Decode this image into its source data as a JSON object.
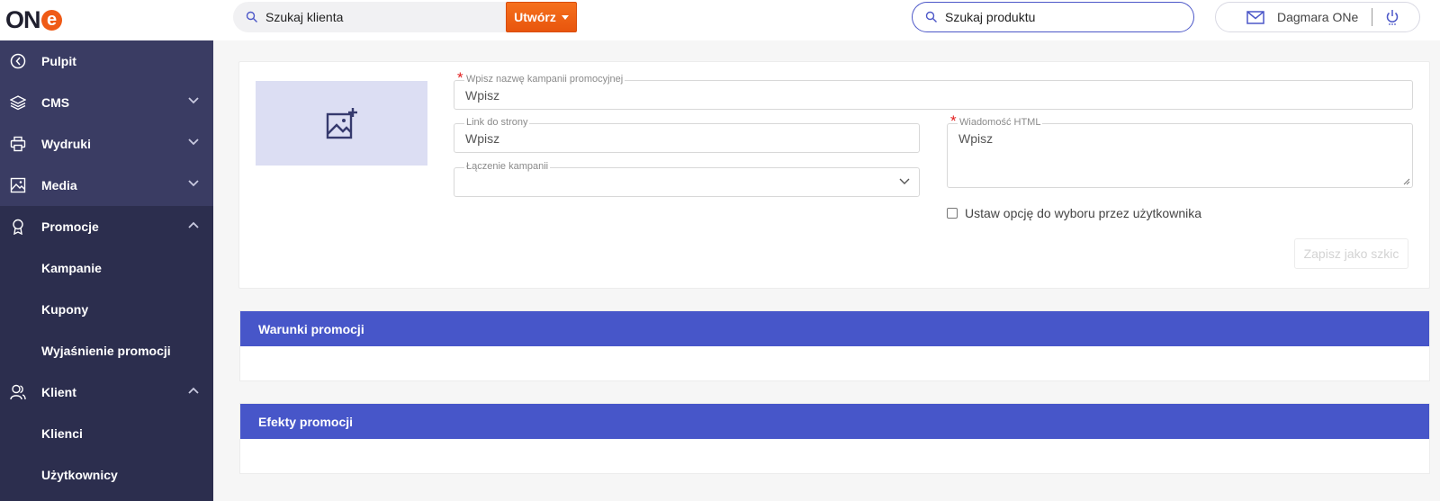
{
  "header": {
    "logo_text": "ON",
    "logo_e": "e",
    "client_search": {
      "placeholder": "Szukaj klienta"
    },
    "create_button": {
      "label": "Utwórz"
    },
    "product_search": {
      "placeholder": "Szukaj produktu"
    },
    "user": {
      "name": "Dagmara ONe"
    }
  },
  "sidebar": {
    "items": [
      {
        "label": "Pulpit",
        "icon": "dashboard-icon"
      },
      {
        "label": "CMS",
        "icon": "layers-icon"
      },
      {
        "label": "Wydruki",
        "icon": "printer-icon"
      },
      {
        "label": "Media",
        "icon": "image-icon"
      },
      {
        "label": "Promocje",
        "icon": "award-icon"
      },
      {
        "label": "Kampanie"
      },
      {
        "label": "Kupony"
      },
      {
        "label": "Wyjaśnienie promocji"
      },
      {
        "label": "Klient",
        "icon": "users-icon"
      },
      {
        "label": "Klienci"
      },
      {
        "label": "Użytkownicy"
      }
    ]
  },
  "form": {
    "campaign_name": {
      "label": "Wpisz nazwę kampanii promocyjnej",
      "value": "Wpisz"
    },
    "link": {
      "label": "Link do strony",
      "value": "Wpisz"
    },
    "joining": {
      "label": "Łączenie kampanii",
      "value": ""
    },
    "html_message": {
      "label": "Wiadomość HTML",
      "value": "Wpisz"
    },
    "user_option": {
      "label": "Ustaw opcję do wyboru przez użytkownika",
      "checked": false
    },
    "save_draft": {
      "label": "Zapisz jako szkic"
    }
  },
  "sections": {
    "conditions": {
      "title": "Warunki promocji"
    },
    "effects": {
      "title": "Efekty promocji"
    }
  },
  "colors": {
    "accent": "#4756c9",
    "sidebar": "#2c2e4e",
    "orange": "#ef5a16"
  }
}
